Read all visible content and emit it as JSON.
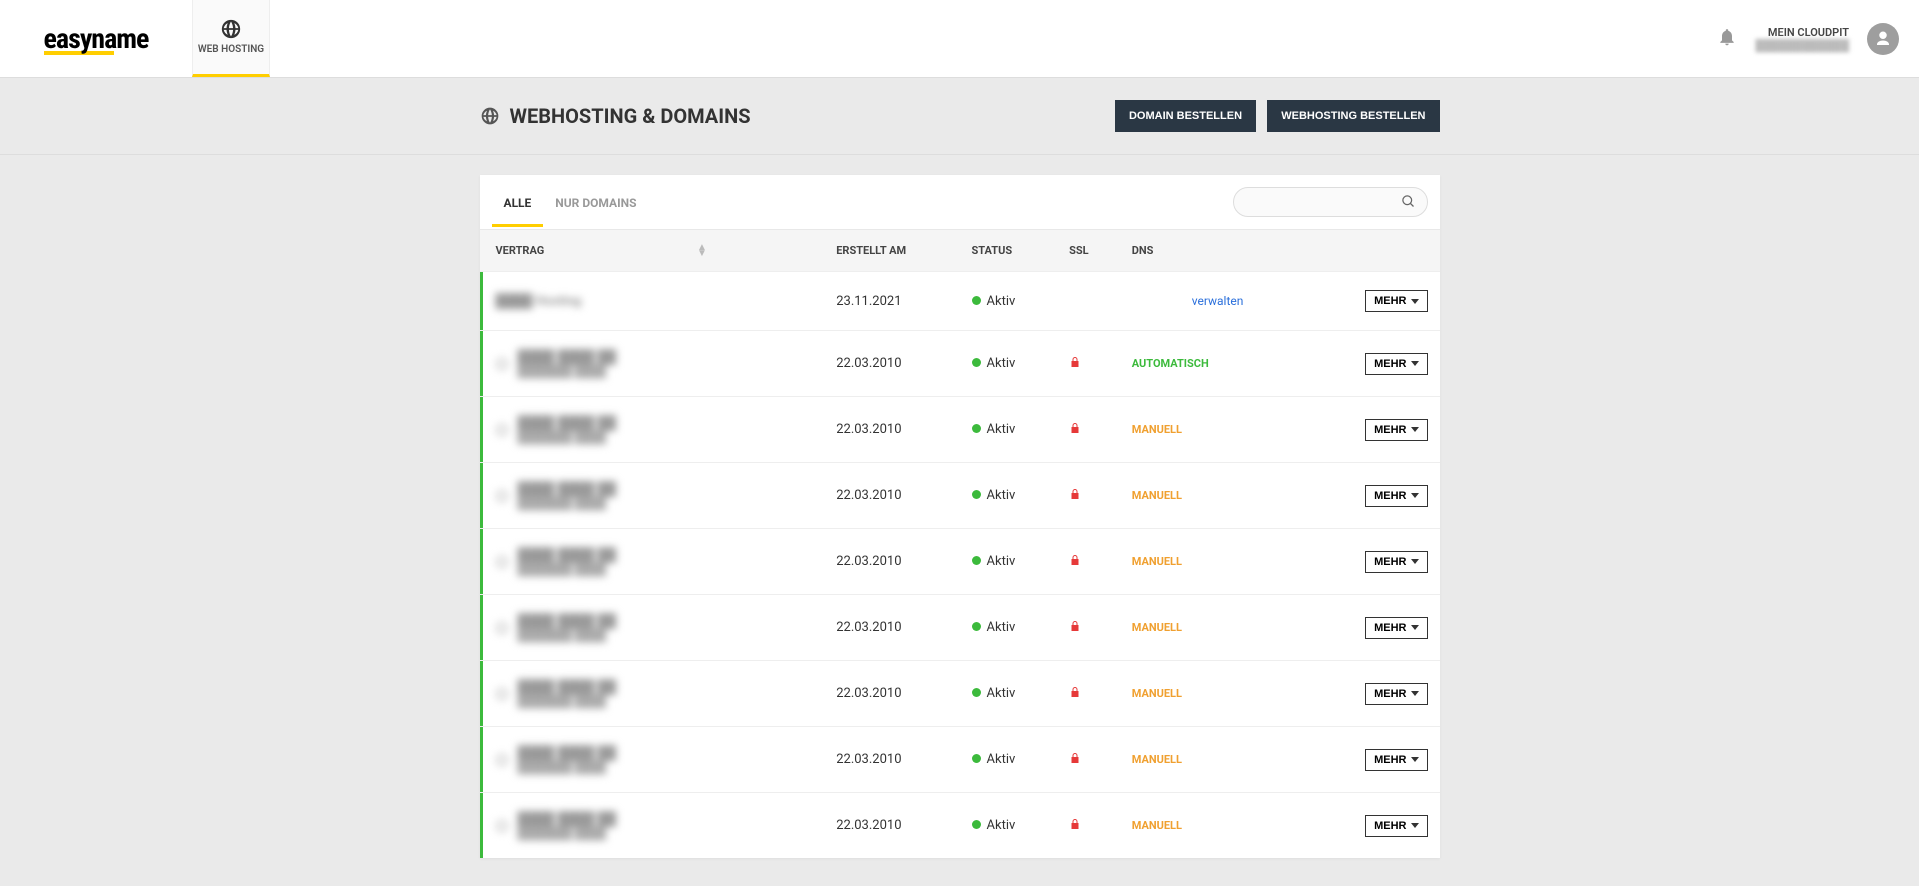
{
  "header": {
    "brand": "easyname",
    "nav_tab_label": "WEB HOSTING",
    "account_label": "MEIN CLOUDPIT"
  },
  "subheader": {
    "title": "WEBHOSTING & DOMAINS",
    "btn_domain": "DOMAIN BESTELLEN",
    "btn_hosting": "WEBHOSTING BESTELLEN"
  },
  "tabs": {
    "all": "ALLE",
    "only_domains": "NUR DOMAINS"
  },
  "columns": {
    "vertrag": "VERTRAG",
    "erstellt": "ERSTELLT AM",
    "status": "STATUS",
    "ssl": "SSL",
    "dns": "DNS"
  },
  "labels": {
    "mehr": "MEHR",
    "aktiv": "Aktiv",
    "verwalten": "verwalten",
    "auto": "AUTOMATISCH",
    "manual": "MANUELL"
  },
  "rows": [
    {
      "vertrag": "████ Hosting",
      "sub": "",
      "radio": false,
      "erstellt": "23.11.2021",
      "status": "Aktiv",
      "ssl": false,
      "dns_type": "link"
    },
    {
      "vertrag": "████ ████ ██",
      "sub": "███████ ████",
      "radio": true,
      "erstellt": "22.03.2010",
      "status": "Aktiv",
      "ssl": true,
      "dns_type": "auto"
    },
    {
      "vertrag": "████ ████ ██",
      "sub": "███████ ████",
      "radio": true,
      "erstellt": "22.03.2010",
      "status": "Aktiv",
      "ssl": true,
      "dns_type": "manual"
    },
    {
      "vertrag": "████ ████ ██",
      "sub": "███████ ████",
      "radio": true,
      "erstellt": "22.03.2010",
      "status": "Aktiv",
      "ssl": true,
      "dns_type": "manual"
    },
    {
      "vertrag": "████ ████ ██",
      "sub": "███████ ████",
      "radio": true,
      "erstellt": "22.03.2010",
      "status": "Aktiv",
      "ssl": true,
      "dns_type": "manual"
    },
    {
      "vertrag": "████ ████ ██",
      "sub": "███████ ████",
      "radio": true,
      "erstellt": "22.03.2010",
      "status": "Aktiv",
      "ssl": true,
      "dns_type": "manual"
    },
    {
      "vertrag": "████ ████ ██",
      "sub": "███████ ████",
      "radio": true,
      "erstellt": "22.03.2010",
      "status": "Aktiv",
      "ssl": true,
      "dns_type": "manual"
    },
    {
      "vertrag": "████ ████ ██",
      "sub": "███████ ████",
      "radio": true,
      "erstellt": "22.03.2010",
      "status": "Aktiv",
      "ssl": true,
      "dns_type": "manual"
    },
    {
      "vertrag": "████ ████ ██",
      "sub": "███████ ████",
      "radio": true,
      "erstellt": "22.03.2010",
      "status": "Aktiv",
      "ssl": true,
      "dns_type": "manual"
    }
  ]
}
